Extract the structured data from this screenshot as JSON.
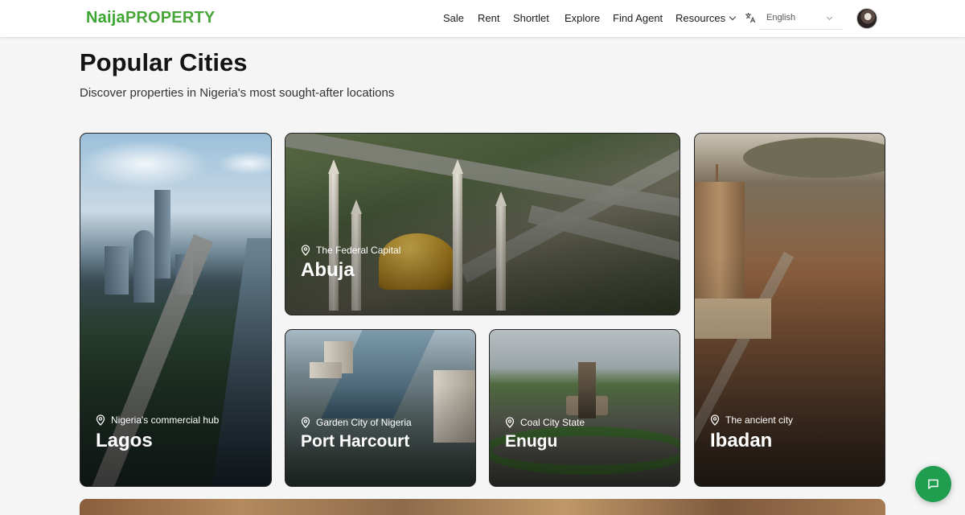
{
  "header": {
    "logo_naija": "Naija",
    "logo_property": "PROPERTY",
    "nav": [
      {
        "label": "Sale"
      },
      {
        "label": "Rent"
      },
      {
        "label": "Shortlet"
      },
      {
        "label": "Explore"
      },
      {
        "label": "Find Agent"
      },
      {
        "label": "Resources"
      }
    ],
    "language": "English",
    "icons": {
      "translate": "translate-icon",
      "avatar": "avatar",
      "dropdown": "chevron-down-icon"
    }
  },
  "main": {
    "title": "Popular Cities",
    "subtitle": "Discover properties in Nigeria's most sought-after locations",
    "cities": [
      {
        "name": "Lagos",
        "tagline": "Nigeria's commercial hub"
      },
      {
        "name": "Abuja",
        "tagline": "The Federal Capital"
      },
      {
        "name": "Port Harcourt",
        "tagline": "Garden City of Nigeria"
      },
      {
        "name": "Enugu",
        "tagline": "Coal City State"
      },
      {
        "name": "Ibadan",
        "tagline": "The ancient city"
      }
    ]
  },
  "chat": {
    "icon": "chat-icon"
  },
  "colors": {
    "brand": "#3aa62f",
    "chat_button": "#1e9e4e",
    "text": "#141414"
  }
}
